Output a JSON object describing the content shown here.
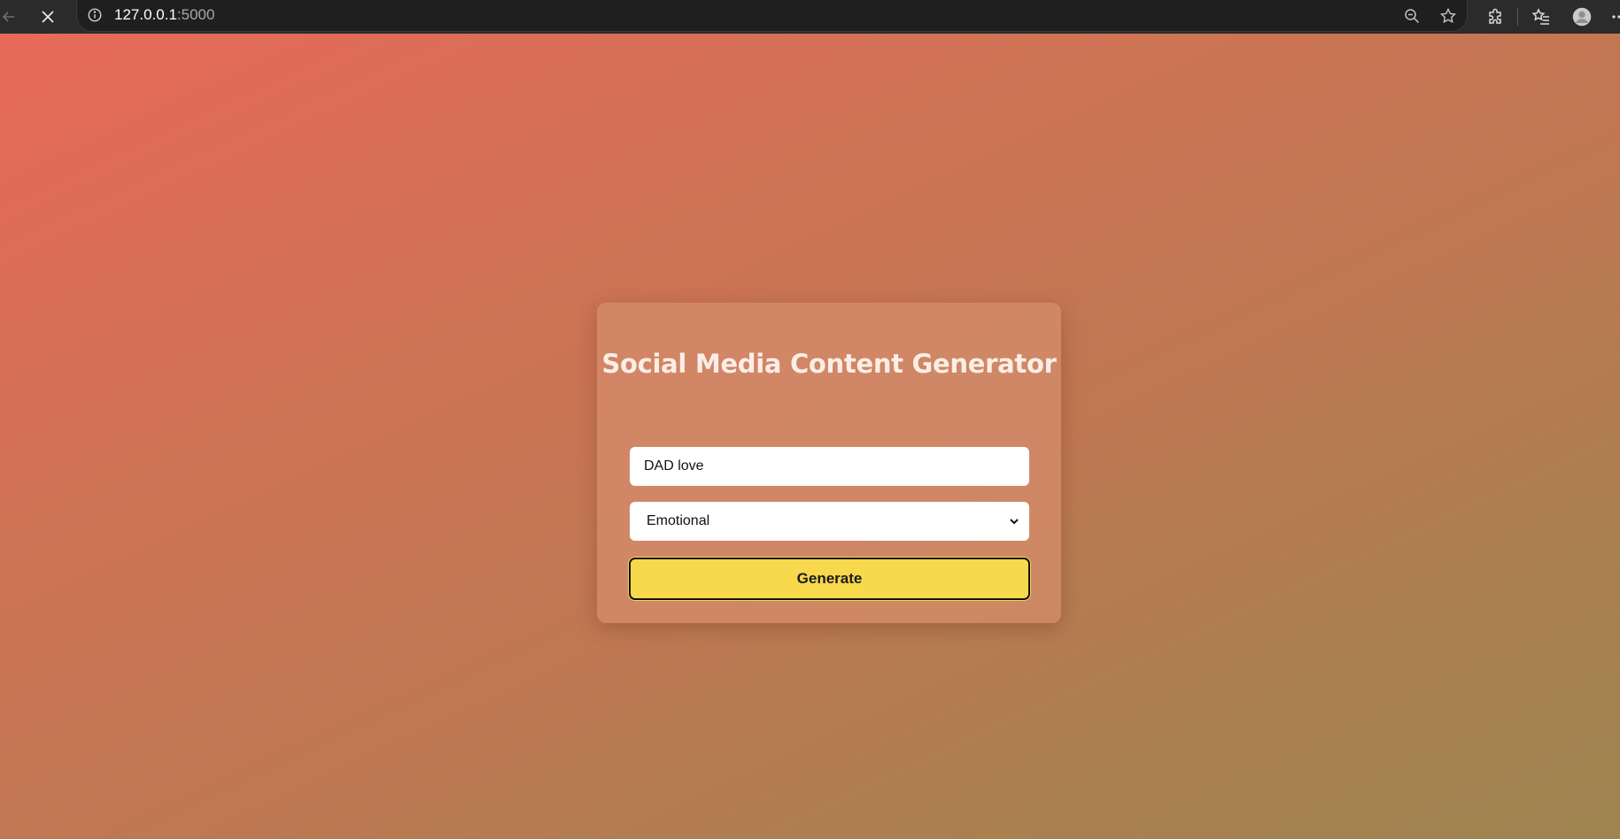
{
  "browser": {
    "url_host": "127.0.0.1",
    "url_port": ":5000",
    "icons": {
      "back": "back-arrow-icon",
      "stop": "close-icon",
      "info": "info-icon",
      "zoom": "zoom-out-icon",
      "bookmark": "star-icon",
      "extensions": "puzzle-icon",
      "favorites": "favorites-icon",
      "profile": "avatar-icon",
      "menu": "more-icon"
    }
  },
  "app": {
    "title": "Social Media Content Generator",
    "topic_input": {
      "value": "DAD love"
    },
    "tone_select": {
      "selected": "Emotional"
    },
    "generate_label": "Generate"
  },
  "colors": {
    "gradient_start": "#e8695a",
    "gradient_end": "#9e8450",
    "button": "#f8d84c"
  }
}
